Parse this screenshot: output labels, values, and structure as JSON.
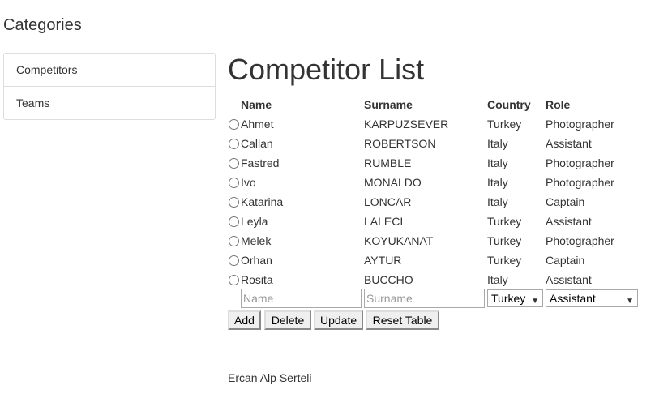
{
  "sidebar": {
    "title": "Categories",
    "items": [
      {
        "label": "Competitors"
      },
      {
        "label": "Teams"
      }
    ]
  },
  "main": {
    "title": "Competitor List",
    "columns": [
      "Name",
      "Surname",
      "Country",
      "Role"
    ],
    "rows": [
      {
        "name": "Ahmet",
        "surname": "KARPUZSEVER",
        "country": "Turkey",
        "role": "Photographer"
      },
      {
        "name": "Callan",
        "surname": "ROBERTSON",
        "country": "Italy",
        "role": "Assistant"
      },
      {
        "name": "Fastred",
        "surname": "RUMBLE",
        "country": "Italy",
        "role": "Photographer"
      },
      {
        "name": "Ivo",
        "surname": "MONALDO",
        "country": "Italy",
        "role": "Photographer"
      },
      {
        "name": "Katarina",
        "surname": "LONCAR",
        "country": "Italy",
        "role": "Captain"
      },
      {
        "name": "Leyla",
        "surname": "LALECI",
        "country": "Turkey",
        "role": "Assistant"
      },
      {
        "name": "Melek",
        "surname": "KOYUKANAT",
        "country": "Turkey",
        "role": "Photographer"
      },
      {
        "name": "Orhan",
        "surname": "AYTUR",
        "country": "Turkey",
        "role": "Captain"
      },
      {
        "name": "Rosita",
        "surname": "BUCCHO",
        "country": "Italy",
        "role": "Assistant"
      }
    ],
    "form": {
      "name_placeholder": "Name",
      "surname_placeholder": "Surname",
      "country_selected": "Turkey",
      "role_selected": "Assistant"
    },
    "buttons": {
      "add": "Add",
      "delete": "Delete",
      "update": "Update",
      "reset": "Reset Table"
    }
  },
  "footer": {
    "author": "Ercan Alp Serteli"
  },
  "colors": {
    "text": "#333333",
    "border": "#dddddd",
    "button_bg": "#efefef"
  }
}
